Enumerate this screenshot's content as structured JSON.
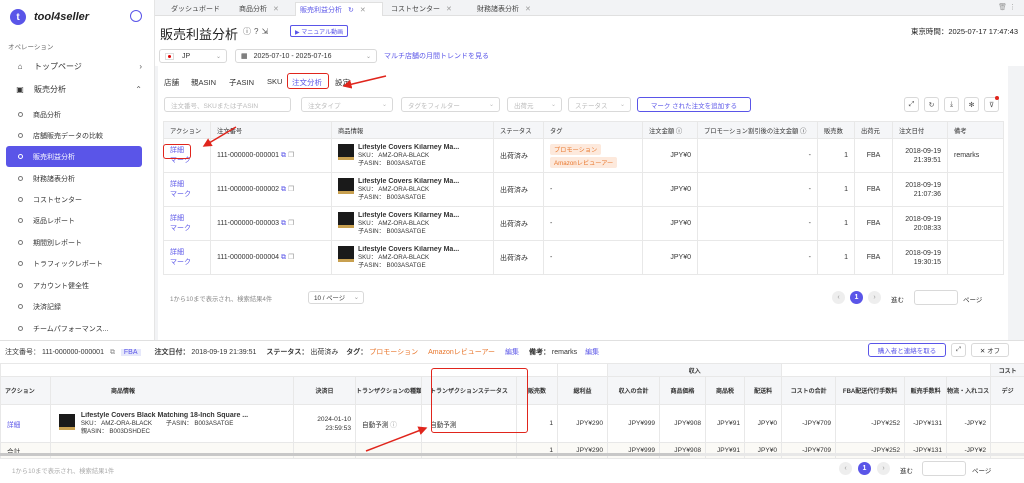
{
  "app": {
    "logo_letter": "t",
    "name": "tool4seller"
  },
  "sidebar": {
    "section": "オペレーション",
    "top": [
      {
        "label": "トップページ",
        "chevron": "›"
      },
      {
        "label": "販売分析",
        "chevron": "⌃"
      }
    ],
    "items": [
      "商品分析",
      "店舗販売データの比較",
      "販売利益分析",
      "財務諸表分析",
      "コストセンター",
      "返品レポート",
      "期間別レポート",
      "トラフィックレポート",
      "アカウント健全性",
      "決済記録",
      "チームパフォーマンス..."
    ]
  },
  "tabs": [
    {
      "label": "ダッシュボード"
    },
    {
      "label": "商品分析"
    },
    {
      "label": "販売利益分析"
    },
    {
      "label": "コストセンター"
    },
    {
      "label": "財務諸表分析"
    }
  ],
  "header": {
    "title": "販売利益分析",
    "manual": "▶ マニュアル動画",
    "system_time": "東京時間：2025-07-17 17:47:43",
    "country": "JP",
    "date_range": "2025-07-10 - 2025-07-16",
    "trend_link": "マルチ店舗の月間トレンドを見る"
  },
  "subtabs": [
    "店舗",
    "親ASIN",
    "子ASIN",
    "SKU",
    "注文分析",
    "設定"
  ],
  "filters": {
    "search": "注文番号、SKUまたは子ASIN",
    "order_type": "注文タイプ",
    "tag": "タグをフィルター",
    "source": "出荷元",
    "status": "ステータス",
    "add_button": "マーク された注文を追加する"
  },
  "order_table": {
    "headers": [
      "アクション",
      "注文番号",
      "商品情報",
      "ステータス",
      "タグ",
      "注文金額 ⓘ",
      "プロモーション割引後の注文金額 ⓘ",
      "販売数",
      "出荷元",
      "注文日付",
      "備考"
    ],
    "rows": [
      {
        "detail": "詳細",
        "mark": "マーク",
        "order": "111-000000-000001",
        "name": "Lifestyle Covers Kilarney Ma...",
        "sku": "SKU： AMZ-ORA-BLACK",
        "asin": "子ASIN： B003ASATGE",
        "status": "出荷済み",
        "tags": [
          "プロモーション",
          "Amazonレビューアー"
        ],
        "amount": "JPY¥0",
        "promo": "-",
        "qty": "1",
        "ship": "FBA",
        "date": "2018-09-19",
        "time": "21:39:51",
        "note": "remarks"
      },
      {
        "detail": "詳細",
        "mark": "マーク",
        "order": "111-000000-000002",
        "name": "Lifestyle Covers Kilarney Ma...",
        "sku": "SKU： AMZ-ORA-BLACK",
        "asin": "子ASIN： B003ASATGE",
        "status": "出荷済み",
        "tags": [
          "-"
        ],
        "amount": "JPY¥0",
        "promo": "-",
        "qty": "1",
        "ship": "FBA",
        "date": "2018-09-19",
        "time": "21:07:36",
        "note": ""
      },
      {
        "detail": "詳細",
        "mark": "マーク",
        "order": "111-000000-000003",
        "name": "Lifestyle Covers Kilarney Ma...",
        "sku": "SKU： AMZ-ORA-BLACK",
        "asin": "子ASIN： B003ASATGE",
        "status": "出荷済み",
        "tags": [
          "-"
        ],
        "amount": "JPY¥0",
        "promo": "-",
        "qty": "1",
        "ship": "FBA",
        "date": "2018-09-19",
        "time": "20:08:33",
        "note": ""
      },
      {
        "detail": "詳細",
        "mark": "マーク",
        "order": "111-000000-000004",
        "name": "Lifestyle Covers Kilarney Ma...",
        "sku": "SKU： AMZ-ORA-BLACK",
        "asin": "子ASIN： B003ASATGE",
        "status": "出荷済み",
        "tags": [
          "-"
        ],
        "amount": "JPY¥0",
        "promo": "-",
        "qty": "1",
        "ship": "FBA",
        "date": "2018-09-19",
        "time": "19:30:15",
        "note": ""
      }
    ]
  },
  "pager": {
    "info": "1から10まで表示され、検索結果4件",
    "per_page": "10 / ページ",
    "page": "1",
    "goto": "進む",
    "page_word": "ページ"
  },
  "bottom": {
    "order_label": "注文番号：",
    "order_no": "111-000000-000001",
    "fba": "FBA",
    "date_label": "注文日付：",
    "date": "2018-09-19 21:39:51",
    "status_label": "ステータス：",
    "status": "出荷済み",
    "tag_label": "タグ：",
    "tag1": "プロモーション",
    "tag2": "Amazonレビューアー",
    "edit": "編集",
    "note_label": "備考：",
    "note": "remarks",
    "edit2": "編集",
    "contact_btn": "購入者と連絡を取る",
    "off_btn": "✕ オフ",
    "group_income": "収入",
    "group_cost": "コスト",
    "headers": [
      "アクション",
      "商品情報",
      "決済日",
      "トランザクションの種類",
      "トランザクションステータス",
      "販売数",
      "総利益",
      "収入の合計",
      "商品価格",
      "商品税",
      "配送料",
      "コストの合計",
      "FBA配送代行手数料",
      "販売手数料",
      "物流・入れコスト",
      "デジ"
    ],
    "row": {
      "detail": "詳細",
      "name": "Lifestyle Covers Black Matching 18-Inch Square ...",
      "sku": "SKU： AMZ-ORA-BLACK",
      "child": "子ASIN： B003ASATGE",
      "parent": "親ASIN： B003DSHDEC",
      "date": "2024-01-10",
      "time": "23:59:53",
      "type": "自動予測",
      "tstatus": "自動予測",
      "qty": "1",
      "profit": "JPY¥290",
      "income": "JPY¥999",
      "price": "JPY¥908",
      "tax": "JPY¥91",
      "ship": "JPY¥0",
      "cost": "-JPY¥709",
      "fba": "-JPY¥252",
      "fee": "-JPY¥131",
      "logi": "-JPY¥2"
    },
    "total": {
      "label": "合計",
      "qty": "1",
      "profit": "JPY¥290",
      "income": "JPY¥999",
      "price": "JPY¥908",
      "tax": "JPY¥91",
      "ship": "JPY¥0",
      "cost": "-JPY¥709",
      "fba": "-JPY¥252",
      "fee": "-JPY¥131",
      "logi": "-JPY¥2"
    },
    "footer": "1から10まで表示され、検索結果1件",
    "page": "1",
    "goto": "進む",
    "page_word": "ページ"
  }
}
